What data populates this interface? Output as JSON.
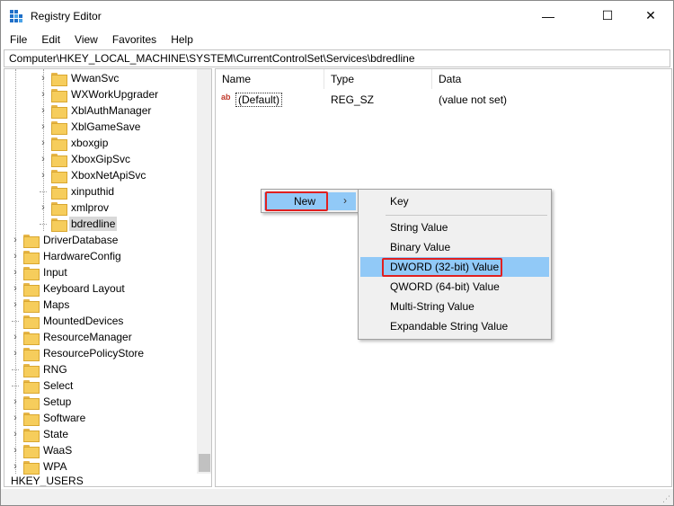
{
  "window": {
    "title": "Registry Editor",
    "controls": {
      "minimize": "—",
      "maximize": "☐",
      "close": "✕"
    }
  },
  "menu": [
    "File",
    "Edit",
    "View",
    "Favorites",
    "Help"
  ],
  "address": "Computer\\HKEY_LOCAL_MACHINE\\SYSTEM\\CurrentControlSet\\Services\\bdredline",
  "tree": {
    "service_children": [
      {
        "label": "WwanSvc",
        "expandable": true
      },
      {
        "label": "WXWorkUpgrader",
        "expandable": true
      },
      {
        "label": "XblAuthManager",
        "expandable": true
      },
      {
        "label": "XblGameSave",
        "expandable": true
      },
      {
        "label": "xboxgip",
        "expandable": true
      },
      {
        "label": "XboxGipSvc",
        "expandable": true
      },
      {
        "label": "XboxNetApiSvc",
        "expandable": true
      },
      {
        "label": "xinputhid",
        "expandable": false
      },
      {
        "label": "xmlprov",
        "expandable": true
      },
      {
        "label": "bdredline",
        "expandable": false,
        "selected": true
      }
    ],
    "system_children": [
      {
        "label": "DriverDatabase",
        "expandable": true
      },
      {
        "label": "HardwareConfig",
        "expandable": true
      },
      {
        "label": "Input",
        "expandable": true
      },
      {
        "label": "Keyboard Layout",
        "expandable": true
      },
      {
        "label": "Maps",
        "expandable": true
      },
      {
        "label": "MountedDevices",
        "expandable": false
      },
      {
        "label": "ResourceManager",
        "expandable": true
      },
      {
        "label": "ResourcePolicyStore",
        "expandable": true
      },
      {
        "label": "RNG",
        "expandable": false
      },
      {
        "label": "Select",
        "expandable": false
      },
      {
        "label": "Setup",
        "expandable": true
      },
      {
        "label": "Software",
        "expandable": true
      },
      {
        "label": "State",
        "expandable": true
      },
      {
        "label": "WaaS",
        "expandable": true
      },
      {
        "label": "WPA",
        "expandable": true
      }
    ],
    "root_partial": "HKEY_USERS"
  },
  "list": {
    "columns": {
      "name": "Name",
      "type": "Type",
      "data": "Data"
    },
    "rows": [
      {
        "name": "(Default)",
        "type": "REG_SZ",
        "data": "(value not set)",
        "icon": "ab"
      }
    ]
  },
  "context_menu": {
    "new_label": "New",
    "submenu_arrow": "›",
    "submenu": [
      "Key",
      "String Value",
      "Binary Value",
      "DWORD (32-bit) Value",
      "QWORD (64-bit) Value",
      "Multi-String Value",
      "Expandable String Value"
    ],
    "highlighted": "DWORD (32-bit) Value",
    "highlight_color": "#e02020",
    "hover_color": "#91c9f7"
  }
}
